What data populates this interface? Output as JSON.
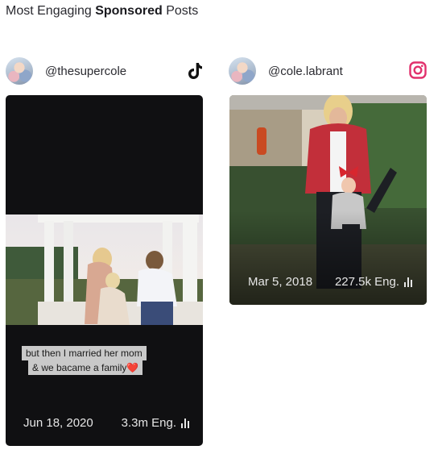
{
  "header": {
    "title_pre": "Most Engaging",
    "title_bold": "Sponsored",
    "title_post": "Posts"
  },
  "posts": [
    {
      "handle": "@thesupercole",
      "network_icon": "tiktok-icon",
      "caption_line1": "but then I married her mom",
      "caption_line2": "& we bacame a family❤️",
      "date": "Jun 18, 2020",
      "engagement": "3.3m Eng."
    },
    {
      "handle": "@cole.labrant",
      "network_icon": "instagram-icon",
      "date": "Mar 5, 2018",
      "engagement": "227.5k Eng."
    }
  ],
  "colors": {
    "instagram": "#e1306c",
    "tiktok": "#111111",
    "card_dark": "#101012"
  }
}
